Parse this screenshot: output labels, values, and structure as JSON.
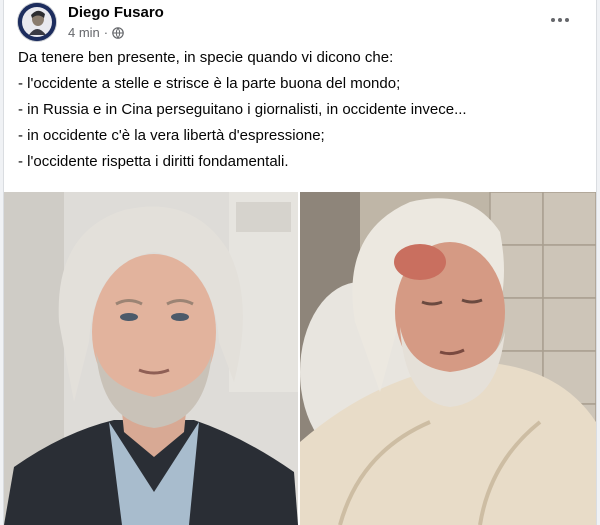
{
  "post": {
    "author": "Diego Fusaro",
    "timestamp": "4 min",
    "separator": "·",
    "audience_icon": "globe-icon",
    "more_icon": "more-horizontal-icon",
    "lines": [
      "Da tenere ben presente, in specie quando vi dicono che:",
      "- l'occidente a stelle e strisce è la parte buona del mondo;",
      "- in Russia e in Cina perseguitano i giornalisti, in occidente invece...",
      "- in occidente c'è la vera libertà d'espressione;",
      "- l'occidente rispetta i diritti fondamentali."
    ]
  },
  "photos": [
    {
      "name": "photo-man-portrait-suit"
    },
    {
      "name": "photo-man-in-bed"
    }
  ]
}
